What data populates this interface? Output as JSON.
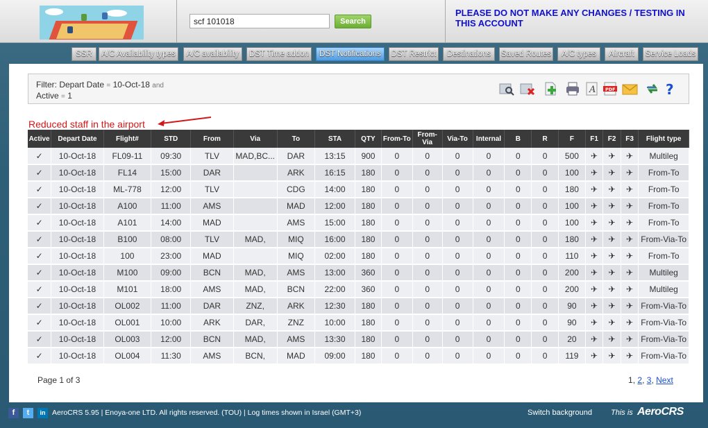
{
  "header": {
    "search_value": "scf 101018",
    "search_label": "Search",
    "warning": "PLEASE DO NOT MAKE ANY CHANGES / TESTING IN THIS ACCOUNT"
  },
  "nav": {
    "tabs": [
      {
        "label": "SSR"
      },
      {
        "label": "A/C Availability types"
      },
      {
        "label": "A/C availability"
      },
      {
        "label": "DST Time addon"
      },
      {
        "label": "DST Notifications",
        "active": true
      },
      {
        "label": "DST Restrict"
      },
      {
        "label": "Destinations"
      },
      {
        "label": "Saved Routes"
      },
      {
        "label": "A/C types"
      },
      {
        "label": "Aircraft"
      },
      {
        "label": "Service Loads"
      }
    ]
  },
  "filter": {
    "line1_label": "Filter: Depart Date",
    "line1_op": "=",
    "line1_value": "10-Oct-18",
    "line1_and": "and",
    "line2_label": "Active",
    "line2_op": "=",
    "line2_value": "1"
  },
  "toolbar": {
    "icons": [
      "search-icon",
      "clear-filter-icon",
      "add-icon",
      "print-icon",
      "font-icon",
      "pdf-icon",
      "mail-icon",
      "refresh-icon",
      "help-icon"
    ],
    "pdf_text": "PDF"
  },
  "notice": "Reduced staff in the airport",
  "table": {
    "headers": [
      "Active",
      "Depart Date",
      "Flight#",
      "STD",
      "From",
      "Via",
      "To",
      "STA",
      "QTY",
      "From-To",
      "From-Via",
      "Via-To",
      "Internal",
      "B",
      "R",
      "F",
      "F1",
      "F2",
      "F3",
      "Flight type"
    ],
    "rows": [
      [
        "✓",
        "10-Oct-18",
        "FL09-11",
        "09:30",
        "TLV",
        "MAD,BC...",
        "DAR",
        "13:15",
        "900",
        "0",
        "0",
        "0",
        "0",
        "0",
        "0",
        "500",
        "Multileg"
      ],
      [
        "✓",
        "10-Oct-18",
        "FL14",
        "15:00",
        "DAR",
        "",
        "ARK",
        "16:15",
        "180",
        "0",
        "0",
        "0",
        "0",
        "0",
        "0",
        "100",
        "From-To"
      ],
      [
        "✓",
        "10-Oct-18",
        "ML-778",
        "12:00",
        "TLV",
        "",
        "CDG",
        "14:00",
        "180",
        "0",
        "0",
        "0",
        "0",
        "0",
        "0",
        "180",
        "From-To"
      ],
      [
        "✓",
        "10-Oct-18",
        "A100",
        "11:00",
        "AMS",
        "",
        "MAD",
        "12:00",
        "180",
        "0",
        "0",
        "0",
        "0",
        "0",
        "0",
        "100",
        "From-To"
      ],
      [
        "✓",
        "10-Oct-18",
        "A101",
        "14:00",
        "MAD",
        "",
        "AMS",
        "15:00",
        "180",
        "0",
        "0",
        "0",
        "0",
        "0",
        "0",
        "100",
        "From-To"
      ],
      [
        "✓",
        "10-Oct-18",
        "B100",
        "08:00",
        "TLV",
        "MAD,",
        "MIQ",
        "16:00",
        "180",
        "0",
        "0",
        "0",
        "0",
        "0",
        "0",
        "180",
        "From-Via-To"
      ],
      [
        "✓",
        "10-Oct-18",
        "100",
        "23:00",
        "MAD",
        "",
        "MIQ",
        "02:00",
        "180",
        "0",
        "0",
        "0",
        "0",
        "0",
        "0",
        "110",
        "From-To"
      ],
      [
        "✓",
        "10-Oct-18",
        "M100",
        "09:00",
        "BCN",
        "MAD,",
        "AMS",
        "13:00",
        "360",
        "0",
        "0",
        "0",
        "0",
        "0",
        "0",
        "200",
        "Multileg"
      ],
      [
        "✓",
        "10-Oct-18",
        "M101",
        "18:00",
        "AMS",
        "MAD,",
        "BCN",
        "22:00",
        "360",
        "0",
        "0",
        "0",
        "0",
        "0",
        "0",
        "200",
        "Multileg"
      ],
      [
        "✓",
        "10-Oct-18",
        "OL002",
        "11:00",
        "DAR",
        "ZNZ,",
        "ARK",
        "12:30",
        "180",
        "0",
        "0",
        "0",
        "0",
        "0",
        "0",
        "90",
        "From-Via-To"
      ],
      [
        "✓",
        "10-Oct-18",
        "OL001",
        "10:00",
        "ARK",
        "DAR,",
        "ZNZ",
        "10:00",
        "180",
        "0",
        "0",
        "0",
        "0",
        "0",
        "0",
        "90",
        "From-Via-To"
      ],
      [
        "✓",
        "10-Oct-18",
        "OL003",
        "12:00",
        "BCN",
        "MAD,",
        "AMS",
        "13:30",
        "180",
        "0",
        "0",
        "0",
        "0",
        "0",
        "0",
        "20",
        "From-Via-To"
      ],
      [
        "✓",
        "10-Oct-18",
        "OL004",
        "11:30",
        "AMS",
        "BCN,",
        "MAD",
        "09:00",
        "180",
        "0",
        "0",
        "0",
        "0",
        "0",
        "0",
        "119",
        "From-Via-To"
      ]
    ]
  },
  "pagination": {
    "info": "Page 1 of 3",
    "current": "1",
    "comma": ",",
    "pages": [
      "2",
      "3"
    ],
    "next": "Next"
  },
  "footer": {
    "social": [
      "f",
      "t",
      "in"
    ],
    "text": "AeroCRS 5.95  |  Enoya-one LTD. All rights reserved. (TOU)  |  Log times shown in Israel (GMT+3)",
    "switch_background": "Switch background",
    "this_is": "This is",
    "brand": "AeroCRS"
  }
}
